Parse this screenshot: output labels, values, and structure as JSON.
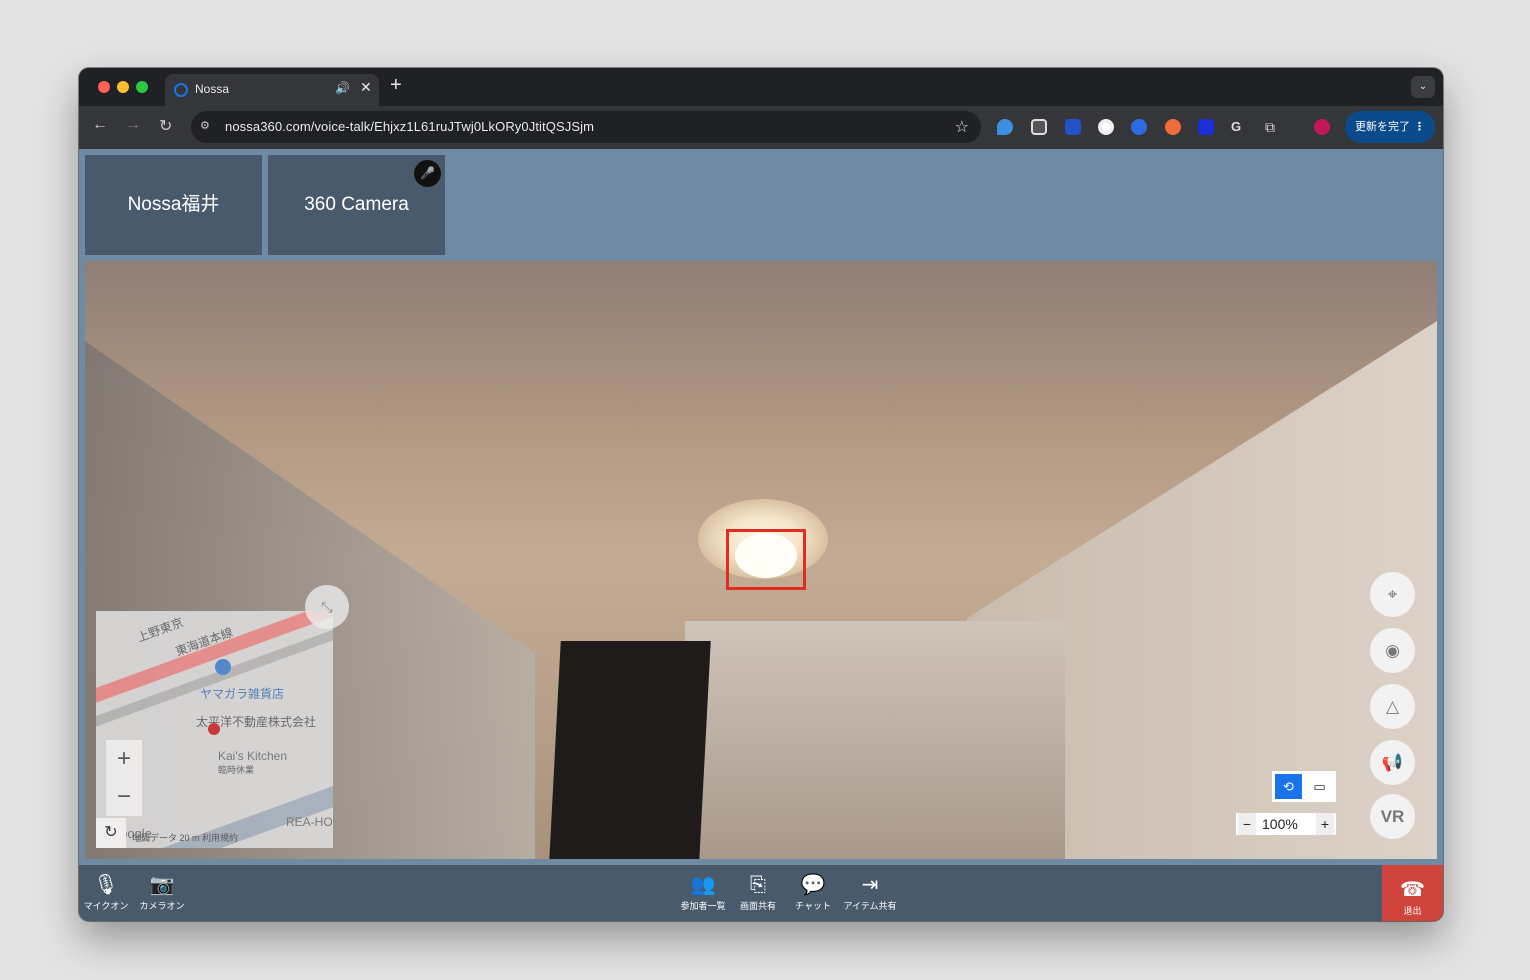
{
  "browser": {
    "tab_title": "Nossa",
    "tab_audio_icon": "speaker-icon",
    "new_tab": "+",
    "url": "nossa360.com/voice-talk/Ehjxz1L61ruJTwj0LkORy0JtitQSJSjm",
    "update_button": "更新を完了",
    "menu_dots": "⋮"
  },
  "participants": [
    {
      "name": "Nossa福井",
      "speaking": false
    },
    {
      "name": "360 Camera",
      "speaking": true
    }
  ],
  "map": {
    "labels": {
      "rail1": "上野東京",
      "rail2": "東海道本線",
      "shop": "ヤマガラ雑貨店",
      "company": "太平洋不動産株式会社",
      "restaurant": "Kai's Kitchen",
      "restaurant_sub": "臨時休業",
      "corner": "REA-HO"
    },
    "footer": "地図データ  20 m            利用規約",
    "logo_text": "Google"
  },
  "viewer": {
    "zoom_value": "100%",
    "vr_label": "VR"
  },
  "controls": {
    "mic": "マイクオン",
    "camera": "カメラオン",
    "participants": "参加者一覧",
    "screen_share": "画面共有",
    "chat": "チャット",
    "item_share": "アイテム共有",
    "leave": "退出"
  },
  "colors": {
    "highlight_border": "#e42b1f",
    "leave_button": "#d0443e",
    "toggle_active": "#1a73e8"
  }
}
